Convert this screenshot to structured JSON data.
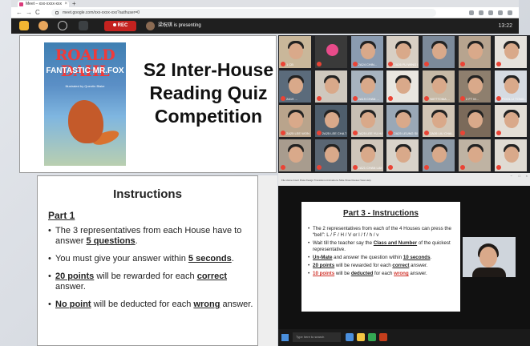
{
  "browser": {
    "tab_title": "Meet – xxx-xxxx-xxx",
    "url": "meet.google.com/xxx-xxxx-xxx?authuser=0",
    "new_tab": "+",
    "close": "×",
    "back": "←",
    "forward": "→",
    "reload": "C"
  },
  "meet": {
    "rec_label": "REC",
    "presenter_text": "梁祝琪 is presenting",
    "time": "13:22"
  },
  "slide1": {
    "book_author": "ROALD DAHL",
    "book_title": "FANTASTIC MR.FOX",
    "book_subtitle": "Illustrated by Quentin Blake",
    "title": "S2 Inter-House Reading Quiz Competition"
  },
  "slide2": {
    "title": "Instructions",
    "part": "Part 1",
    "items": [
      {
        "a": "The 3 representatives from each House have to answer ",
        "b": "5 questions",
        "c": "."
      },
      {
        "a": "You must give your answer within ",
        "b": "5 seconds",
        "c": "."
      },
      {
        "a": "",
        "b": "20 points",
        "c": " will be rewarded for each ",
        "d": "correct",
        "e": " answer."
      },
      {
        "a": "",
        "b": "No point",
        "c": " will be deducted for each ",
        "d": "wrong",
        "e": " answer."
      }
    ]
  },
  "participants": [
    {
      "name": "1 CB"
    },
    {
      "name": ""
    },
    {
      "name": "2A24 CHIN..."
    },
    {
      "name": "2A26 FU WING HEI..."
    },
    {
      "name": ""
    },
    {
      "name": ""
    },
    {
      "name": ""
    },
    {
      "name": "2A19 ..."
    },
    {
      "name": ""
    },
    {
      "name": "2A19 CHAN ..."
    },
    {
      "name": ""
    },
    {
      "name": "NIETTOMA ..."
    },
    {
      "name": "2 FT M..."
    },
    {
      "name": "POOL LI TONG..."
    },
    {
      "name": "2A25 LEE WON HANG..."
    },
    {
      "name": "2A25 LEE CHA TONG"
    },
    {
      "name": "2A25 LEE YU HANG..."
    },
    {
      "name": "2A25 LEUNG SIN..."
    },
    {
      "name": "2A26 LIU CHAI..."
    },
    {
      "name": ""
    },
    {
      "name": ""
    },
    {
      "name": ""
    },
    {
      "name": ""
    },
    {
      "name": "2A21 CHAN LAM..."
    },
    {
      "name": ""
    },
    {
      "name": ""
    },
    {
      "name": ""
    },
    {
      "name": ""
    }
  ],
  "window2": {
    "menu": "File  Home  Insert  Draw  Design  Transitions  Animations  Slide Show  Review  View  Help",
    "taskbar_search": "Type here to search"
  },
  "slide3": {
    "title": "Part 3 - Instructions",
    "items": [
      {
        "html": "The 2 representatives from each of the 4 Houses can press the “bell”: L / F / H / V or l / f / h / v"
      },
      {
        "a": "Wait till the teacher say the ",
        "b": "Class and Number",
        "c": " of the quickest representative."
      },
      {
        "a": "",
        "b": "Un-Mate",
        "c": " and answer the question within ",
        "d": "10 seconds",
        "e": "."
      },
      {
        "a": "",
        "b": "20 points",
        "c": " will be rewarded for each ",
        "d": "correct",
        "e": " answer."
      },
      {
        "a": "",
        "b": "10 points",
        "c": " will be ",
        "d": "deducted",
        "e": " for each ",
        "f": "wrong",
        "g": " answer."
      }
    ]
  }
}
